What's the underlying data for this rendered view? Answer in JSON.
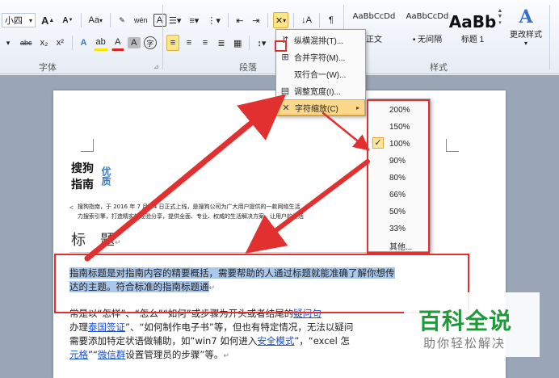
{
  "ribbon": {
    "font": {
      "size_value": "小四",
      "grow_label": "A",
      "shrink_label": "A",
      "case_label": "Aa",
      "phonetic_label": "wén",
      "char_border_label": "A",
      "strike_label": "abc",
      "sub_label": "x₂",
      "sup_label": "x²",
      "effects_label": "A",
      "highlight_label": "ab",
      "color_label": "A",
      "shade_label": "A",
      "enclose_label": "字",
      "group_label": "字体"
    },
    "paragraph": {
      "group_label": "段落"
    },
    "styles": {
      "items": [
        {
          "sample": "AaBbCcDd",
          "name": "正文"
        },
        {
          "sample": "AaBbCcDd",
          "name": "无间隔"
        },
        {
          "sample": "AaBb",
          "name": "标题 1"
        }
      ],
      "change_styles_label": "更改样式",
      "group_label": "样式"
    }
  },
  "menu": {
    "items": [
      {
        "label": "纵横混排(T)...",
        "icon": "vertical-horizontal-icon"
      },
      {
        "label": "合并字符(M)...",
        "icon": "combine-chars-icon"
      },
      {
        "label": "双行合一(W)...",
        "icon": ""
      },
      {
        "label": "调整宽度(I)...",
        "icon": "fit-width-icon"
      },
      {
        "label": "字符缩放(C)",
        "icon": "char-scale-icon"
      }
    ]
  },
  "submenu": {
    "items": [
      "200%",
      "150%",
      "100%",
      "90%",
      "80%",
      "66%",
      "50%",
      "33%",
      "其他..."
    ],
    "checked": "100%"
  },
  "document": {
    "logo_line1": "搜狗",
    "logo_line2": "指南",
    "logo_tag": "优质",
    "intro_line1": "搜狗指南，于 2016 年 7 月 14 日正式上线，是搜狗公司为广大用户提供的一款网络生活",
    "intro_line2": "力搜索引擎，打造精实的经验分享，提供全面、专业、权威的生活解决方案，让用户的生活",
    "heading": "标　题",
    "para1_line1": "指南标题是对指南内容的精要概括，需要帮助的人通过标题就能准确了解你想传",
    "para1_line2": "达的主题。符合标准的指南标题通",
    "para2_line1a": "常是以“怎样”、“怎么”“如何”或步骤为开头或者结尾的",
    "para2_link1": "疑问句",
    "para2_line2a": "办理",
    "para2_link2": "泰国签证",
    "para2_line2b": "”、“如何制作电子书”等，但也有特定情况，无法以疑问",
    "para2_line3a": "需要添加特定状语做辅助，如“win7 如何进入",
    "para2_link3": "安全模式",
    "para2_line3b": "”，“excel 怎",
    "para2_link4": "元格",
    "para2_line4a": "”“",
    "para2_link5": "微信群",
    "para2_line4b": "设置管理员的步骤”等。"
  },
  "watermark": {
    "title": "百科全说",
    "subtitle": "助你轻松解决"
  },
  "colors": {
    "annotation_red": "#e03030",
    "highlight_blue": "#a9c8ec",
    "menu_highlight": "#fcd98a",
    "watermark_green": "#1f9a3a"
  }
}
